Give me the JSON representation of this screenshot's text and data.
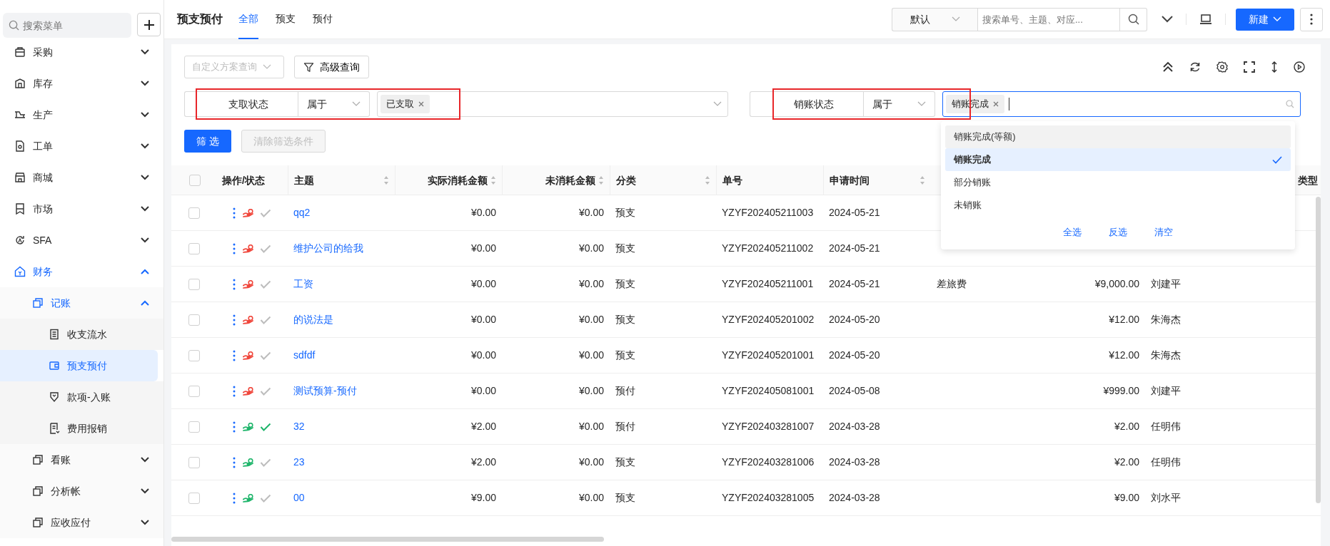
{
  "sidebar": {
    "search_placeholder": "搜索菜单",
    "items": [
      {
        "label": "采购",
        "expanded": false
      },
      {
        "label": "库存",
        "expanded": false
      },
      {
        "label": "生产",
        "expanded": false
      },
      {
        "label": "工单",
        "expanded": false
      },
      {
        "label": "商城",
        "expanded": false
      },
      {
        "label": "市场",
        "expanded": false
      },
      {
        "label": "SFA",
        "expanded": false
      },
      {
        "label": "财务",
        "expanded": true,
        "children": [
          {
            "label": "记账",
            "expanded": true,
            "children": [
              {
                "label": "收支流水",
                "selected": false
              },
              {
                "label": "预支预付",
                "selected": true
              },
              {
                "label": "款项-入账",
                "selected": false
              },
              {
                "label": "费用报销",
                "selected": false
              }
            ]
          },
          {
            "label": "看账",
            "expanded": false
          },
          {
            "label": "分析帐",
            "expanded": false
          },
          {
            "label": "应收应付",
            "expanded": false
          }
        ]
      }
    ]
  },
  "header": {
    "title": "预支预付",
    "tabs": [
      {
        "label": "全部",
        "selected": true
      },
      {
        "label": "预支",
        "selected": false
      },
      {
        "label": "预付",
        "selected": false
      }
    ],
    "view_select": "默认",
    "search_placeholder": "搜索单号、主题、对应...",
    "new_button": "新建"
  },
  "filters": {
    "scheme_placeholder": "自定义方案查询",
    "advanced_button": "高级查询",
    "conditions": [
      {
        "field": "支取状态",
        "operator": "属于",
        "tags": [
          "已支取"
        ],
        "focused": false,
        "highlighted": true
      },
      {
        "field": "销账状态",
        "operator": "属于",
        "tags": [
          "销账完成"
        ],
        "focused": true,
        "highlighted": true
      }
    ],
    "apply_button": "筛 选",
    "clear_button": "清除筛选条件",
    "clear_disabled": true
  },
  "dropdown": {
    "options": [
      {
        "label": "销账完成(等额)",
        "selected": false,
        "hovered": true
      },
      {
        "label": "销账完成",
        "selected": true,
        "hovered": false
      },
      {
        "label": "部分销账",
        "selected": false,
        "hovered": false
      },
      {
        "label": "未销账",
        "selected": false,
        "hovered": false
      }
    ],
    "actions": [
      "全选",
      "反选",
      "清空"
    ]
  },
  "table": {
    "all_selected": false,
    "columns": [
      {
        "label": "操作/状态",
        "sortable": false
      },
      {
        "label": "主题",
        "sortable": true
      },
      {
        "label": "实际消耗金额",
        "sortable": true
      },
      {
        "label": "未消耗金额",
        "sortable": true
      },
      {
        "label": "分类",
        "sortable": true
      },
      {
        "label": "单号",
        "sortable": false
      },
      {
        "label": "申请时间",
        "sortable": true
      },
      {
        "label": "类型",
        "sortable": false
      }
    ],
    "rows": [
      {
        "selected": false,
        "color": "#f0473c",
        "approved": false,
        "subject": "qq2",
        "actual": "¥0.00",
        "remaining": "¥0.00",
        "category": "预支",
        "number": "YZYF202405211003",
        "date": "2024-05-21"
      },
      {
        "selected": false,
        "color": "#f0473c",
        "approved": false,
        "subject": "维护公司的给我",
        "actual": "¥0.00",
        "remaining": "¥0.00",
        "category": "预支",
        "number": "YZYF202405211002",
        "date": "2024-05-21"
      },
      {
        "selected": false,
        "color": "#f0473c",
        "approved": false,
        "subject": "工资",
        "actual": "¥0.00",
        "remaining": "¥0.00",
        "category": "预支",
        "number": "YZYF202405211001",
        "date": "2024-05-21",
        "column_9": "差旅费",
        "column_10": "¥9,000.00",
        "column_11": "刘建平"
      },
      {
        "selected": false,
        "color": "#f0473c",
        "approved": false,
        "subject": "的说法是",
        "actual": "¥0.00",
        "remaining": "¥0.00",
        "category": "预支",
        "number": "YZYF202405201002",
        "date": "2024-05-20",
        "column_10": "¥12.00",
        "column_11": "朱海杰"
      },
      {
        "selected": false,
        "color": "#f0473c",
        "approved": false,
        "subject": "sdfdf",
        "actual": "¥0.00",
        "remaining": "¥0.00",
        "category": "预支",
        "number": "YZYF202405201001",
        "date": "2024-05-20",
        "column_10": "¥12.00",
        "column_11": "朱海杰"
      },
      {
        "selected": false,
        "color": "#f0473c",
        "approved": false,
        "subject": "测试预算-预付",
        "actual": "¥0.00",
        "remaining": "¥0.00",
        "category": "预付",
        "number": "YZYF202405081001",
        "date": "2024-05-08",
        "column_10": "¥999.00",
        "column_11": "刘建平"
      },
      {
        "selected": false,
        "color": "#1fb56b",
        "approved": true,
        "subject": "32",
        "actual": "¥2.00",
        "remaining": "¥0.00",
        "category": "预付",
        "number": "YZYF202403281007",
        "date": "2024-03-28",
        "column_10": "¥2.00",
        "column_11": "任明伟"
      },
      {
        "selected": false,
        "color": "#1fb56b",
        "approved": false,
        "subject": "23",
        "actual": "¥2.00",
        "remaining": "¥0.00",
        "category": "预支",
        "number": "YZYF202403281006",
        "date": "2024-03-28",
        "column_10": "¥2.00",
        "column_11": "任明伟"
      },
      {
        "selected": false,
        "color": "#1fb56b",
        "approved": false,
        "subject": "00",
        "actual": "¥9.00",
        "remaining": "¥0.00",
        "category": "预支",
        "number": "YZYF202403281005",
        "date": "2024-03-28",
        "column_10": "¥9.00",
        "column_11": "刘水平"
      }
    ]
  }
}
